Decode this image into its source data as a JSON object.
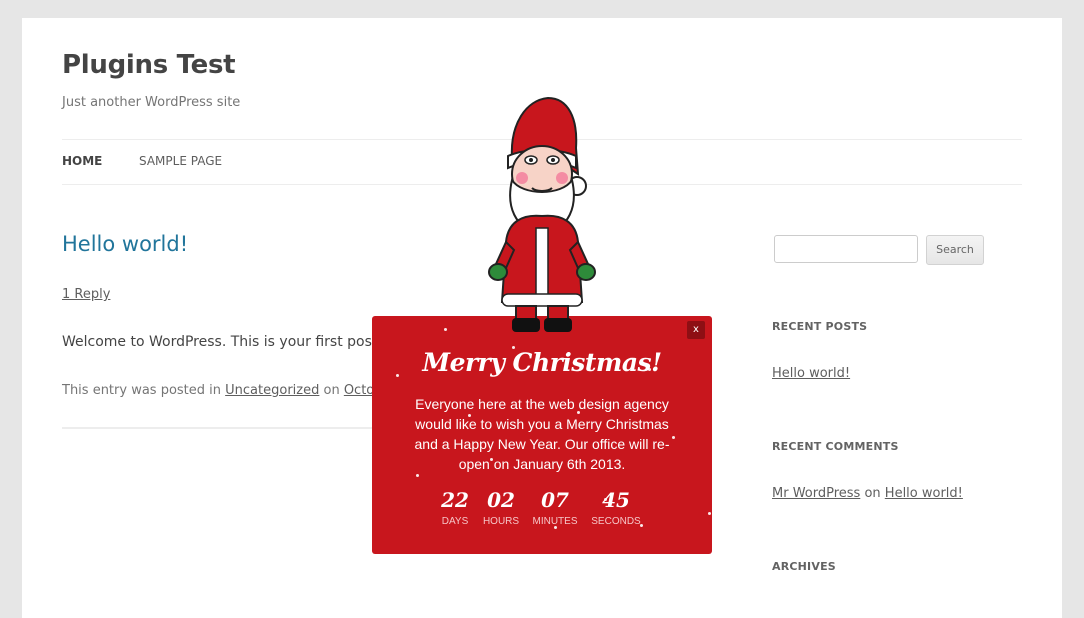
{
  "site": {
    "title": "Plugins Test",
    "description": "Just another WordPress site"
  },
  "nav": {
    "home": "HOME",
    "sample_page": "SAMPLE PAGE"
  },
  "post": {
    "title": "Hello world!",
    "reply_link": "1 Reply",
    "body": "Welcome to WordPress. This is your first post. E",
    "meta_prefix": "This entry was posted in ",
    "meta_category": "Uncategorized",
    "meta_on": " on ",
    "meta_date": "October"
  },
  "sidebar": {
    "search_button": "Search",
    "search_value": "",
    "recent_posts_title": "RECENT POSTS",
    "recent_post_1": "Hello world!",
    "recent_comments_title": "RECENT COMMENTS",
    "comment_author": "Mr WordPress",
    "comment_on": " on ",
    "comment_post": "Hello world!",
    "archives_title": "ARCHIVES"
  },
  "popup": {
    "close_label": "x",
    "title": "Merry Christmas!",
    "message": "Everyone here at the web design agency would like to wish you a Merry Christmas and a Happy New Year. Our office will re-open on January 6th 2013.",
    "countdown": {
      "days": "22",
      "days_label": "DAYS",
      "hours": "02",
      "hours_label": "HOURS",
      "minutes": "07",
      "minutes_label": "MINUTES",
      "seconds": "45",
      "seconds_label": "SECONDS"
    },
    "colors": {
      "background": "#c8161d",
      "close_bg": "#8e0f14"
    }
  },
  "icons": {
    "mascot": "santa-claus-icon"
  }
}
